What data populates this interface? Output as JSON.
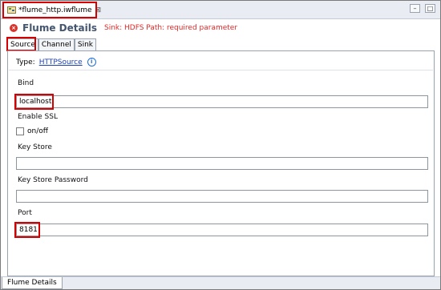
{
  "editor_tab": {
    "title": "*flume_http.iwflume",
    "close_glyph": "⊠"
  },
  "window": {
    "minimize_glyph": "–",
    "maximize_glyph": "□"
  },
  "form": {
    "title": "Flume Details",
    "error_message": "Sink: HDFS Path: required parameter"
  },
  "subtabs": [
    {
      "label": "Source",
      "active": true
    },
    {
      "label": "Channel",
      "active": false
    },
    {
      "label": "Sink",
      "active": false
    }
  ],
  "type_row": {
    "label": "Type:",
    "link": "HTTPSource"
  },
  "fields": {
    "bind": {
      "label": "Bind",
      "value": "localhost"
    },
    "ssl": {
      "label": "Enable SSL",
      "checkbox_label": "on/off",
      "checked": false
    },
    "key_store": {
      "label": "Key Store",
      "value": ""
    },
    "key_store_password": {
      "label": "Key Store Password",
      "value": ""
    },
    "port": {
      "label": "Port",
      "value": "8181"
    }
  },
  "bottom_tab": {
    "label": "Flume Details"
  },
  "icons": {
    "file": "flume-file-icon",
    "error": "error-icon",
    "info": "info-icon"
  },
  "colors": {
    "error": "#e32727",
    "title": "#44556f",
    "link": "#1a3fb8",
    "highlight": "#d60000"
  }
}
